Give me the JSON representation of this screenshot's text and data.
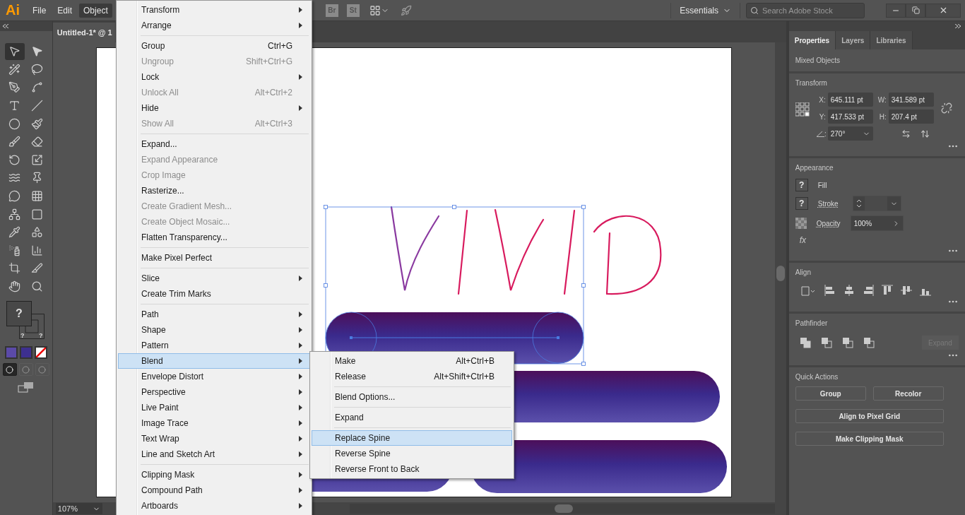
{
  "app": {
    "logo": "Ai",
    "menus": [
      {
        "label": "File",
        "selected": false
      },
      {
        "label": "Edit",
        "selected": false
      },
      {
        "label": "Object",
        "selected": true
      }
    ],
    "badges": [
      "Br",
      "St"
    ]
  },
  "workspace": {
    "label": "Essentials"
  },
  "search": {
    "placeholder": "Search Adobe Stock"
  },
  "document": {
    "tab_title": "Untitled-1* @ 1",
    "zoom": "107%"
  },
  "tools": [
    {
      "kind": "selection",
      "selected": true
    },
    {
      "kind": "direct-selection",
      "selected": false
    },
    {
      "kind": "magic-wand",
      "selected": false
    },
    {
      "kind": "lasso",
      "selected": false
    },
    {
      "kind": "pen",
      "selected": false
    },
    {
      "kind": "curvature",
      "selected": false
    },
    {
      "kind": "type",
      "selected": false
    },
    {
      "kind": "line",
      "selected": false
    },
    {
      "kind": "ellipse",
      "selected": false
    },
    {
      "kind": "paintbrush",
      "selected": false
    },
    {
      "kind": "shaper",
      "selected": false
    },
    {
      "kind": "eraser",
      "selected": false
    },
    {
      "kind": "rotate",
      "selected": false
    },
    {
      "kind": "scale",
      "selected": false
    },
    {
      "kind": "warp",
      "selected": false
    },
    {
      "kind": "pin",
      "selected": false
    },
    {
      "kind": "free-transform",
      "selected": false
    },
    {
      "kind": "perspective",
      "selected": false
    },
    {
      "kind": "mesh",
      "selected": false
    },
    {
      "kind": "gradient",
      "selected": false
    },
    {
      "kind": "eyedropper",
      "selected": false
    },
    {
      "kind": "blend",
      "selected": false
    },
    {
      "kind": "symbol",
      "selected": false
    },
    {
      "kind": "graph",
      "selected": false
    },
    {
      "kind": "artboard",
      "selected": false
    },
    {
      "kind": "slice",
      "selected": false
    },
    {
      "kind": "hand",
      "selected": false
    },
    {
      "kind": "zoom",
      "selected": false
    }
  ],
  "fill_stroke": {
    "fill_mark": "?",
    "stroke_marks": [
      "?",
      "?"
    ]
  },
  "color_modes": [
    {
      "kind": "color",
      "color": "#5b4aa8"
    },
    {
      "kind": "gradient",
      "color": "#3d2f8f"
    },
    {
      "kind": "none",
      "color": "#ffffff"
    }
  ],
  "draw_modes": [
    {
      "selected": true
    },
    {
      "selected": false
    },
    {
      "selected": false
    }
  ],
  "object_menu": {
    "groups": [
      [
        {
          "label": "Transform",
          "submenu": true,
          "disabled": false,
          "selected": false
        },
        {
          "label": "Arrange",
          "submenu": true,
          "disabled": false,
          "selected": false
        }
      ],
      [
        {
          "label": "Group",
          "shortcut": "Ctrl+G",
          "submenu": false,
          "disabled": false,
          "selected": false
        },
        {
          "label": "Ungroup",
          "shortcut": "Shift+Ctrl+G",
          "submenu": false,
          "disabled": true,
          "selected": false
        },
        {
          "label": "Lock",
          "submenu": true,
          "disabled": false,
          "selected": false
        },
        {
          "label": "Unlock All",
          "shortcut": "Alt+Ctrl+2",
          "submenu": false,
          "disabled": true,
          "selected": false
        },
        {
          "label": "Hide",
          "submenu": true,
          "disabled": false,
          "selected": false
        },
        {
          "label": "Show All",
          "shortcut": "Alt+Ctrl+3",
          "submenu": false,
          "disabled": true,
          "selected": false
        }
      ],
      [
        {
          "label": "Expand...",
          "submenu": false,
          "disabled": false,
          "selected": false
        },
        {
          "label": "Expand Appearance",
          "submenu": false,
          "disabled": true,
          "selected": false
        },
        {
          "label": "Crop Image",
          "submenu": false,
          "disabled": true,
          "selected": false
        },
        {
          "label": "Rasterize...",
          "submenu": false,
          "disabled": false,
          "selected": false
        },
        {
          "label": "Create Gradient Mesh...",
          "submenu": false,
          "disabled": true,
          "selected": false
        },
        {
          "label": "Create Object Mosaic...",
          "submenu": false,
          "disabled": true,
          "selected": false
        },
        {
          "label": "Flatten Transparency...",
          "submenu": false,
          "disabled": false,
          "selected": false
        }
      ],
      [
        {
          "label": "Make Pixel Perfect",
          "submenu": false,
          "disabled": false,
          "selected": false
        }
      ],
      [
        {
          "label": "Slice",
          "submenu": true,
          "disabled": false,
          "selected": false
        },
        {
          "label": "Create Trim Marks",
          "submenu": false,
          "disabled": false,
          "selected": false
        }
      ],
      [
        {
          "label": "Path",
          "submenu": true,
          "disabled": false,
          "selected": false
        },
        {
          "label": "Shape",
          "submenu": true,
          "disabled": false,
          "selected": false
        },
        {
          "label": "Pattern",
          "submenu": true,
          "disabled": false,
          "selected": false
        },
        {
          "label": "Blend",
          "submenu": true,
          "disabled": false,
          "selected": true
        },
        {
          "label": "Envelope Distort",
          "submenu": true,
          "disabled": false,
          "selected": false
        },
        {
          "label": "Perspective",
          "submenu": true,
          "disabled": false,
          "selected": false
        },
        {
          "label": "Live Paint",
          "submenu": true,
          "disabled": false,
          "selected": false
        },
        {
          "label": "Image Trace",
          "submenu": true,
          "disabled": false,
          "selected": false
        },
        {
          "label": "Text Wrap",
          "submenu": true,
          "disabled": false,
          "selected": false
        },
        {
          "label": "Line and Sketch Art",
          "submenu": true,
          "disabled": false,
          "selected": false
        }
      ],
      [
        {
          "label": "Clipping Mask",
          "submenu": true,
          "disabled": false,
          "selected": false
        },
        {
          "label": "Compound Path",
          "submenu": true,
          "disabled": false,
          "selected": false
        },
        {
          "label": "Artboards",
          "submenu": true,
          "disabled": false,
          "selected": false
        }
      ]
    ]
  },
  "blend_submenu": {
    "groups": [
      [
        {
          "label": "Make",
          "shortcut": "Alt+Ctrl+B",
          "submenu": false,
          "disabled": false,
          "selected": false
        },
        {
          "label": "Release",
          "shortcut": "Alt+Shift+Ctrl+B",
          "submenu": false,
          "disabled": false,
          "selected": false
        }
      ],
      [
        {
          "label": "Blend Options...",
          "submenu": false,
          "disabled": false,
          "selected": false
        }
      ],
      [
        {
          "label": "Expand",
          "submenu": false,
          "disabled": false,
          "selected": false
        }
      ],
      [
        {
          "label": "Replace Spine",
          "submenu": false,
          "disabled": false,
          "selected": true
        },
        {
          "label": "Reverse Spine",
          "submenu": false,
          "disabled": false,
          "selected": false
        },
        {
          "label": "Reverse Front to Back",
          "submenu": false,
          "disabled": false,
          "selected": false
        }
      ]
    ]
  },
  "panel": {
    "tabs": [
      {
        "label": "Properties",
        "selected": true
      },
      {
        "label": "Layers",
        "selected": false
      },
      {
        "label": "Libraries",
        "selected": false
      }
    ],
    "selection_label": "Mixed Objects",
    "transform": {
      "title": "Transform",
      "fields": [
        {
          "label": "X:",
          "value": "645.111 pt"
        },
        {
          "label": "W:",
          "value": "341.589 pt"
        },
        {
          "label": "Y:",
          "value": "417.533 pt"
        },
        {
          "label": "H:",
          "value": "207.4 pt"
        }
      ],
      "angle": {
        "label": ":",
        "value": "270°"
      }
    },
    "appearance": {
      "title": "Appearance",
      "rows": [
        {
          "kind": "fill",
          "swatch": "?",
          "label": "Fill"
        },
        {
          "kind": "stroke",
          "swatch": "?",
          "label": "Stroke"
        },
        {
          "kind": "opacity",
          "label": "Opacity",
          "value": "100%"
        }
      ],
      "effects_label": "fx"
    },
    "align": {
      "title": "Align"
    },
    "pathfinder": {
      "title": "Pathfinder",
      "button": {
        "label": "Expand",
        "disabled": true
      }
    },
    "quick_actions": {
      "title": "Quick Actions",
      "buttons": [
        "Group",
        "Recolor",
        "Align to Pixel Grid",
        "Make Clipping Mask"
      ]
    }
  }
}
